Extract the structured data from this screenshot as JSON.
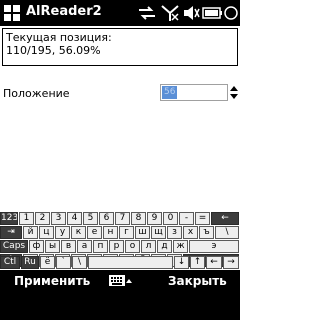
{
  "titlebar": {
    "title": "AlReader2",
    "icons": [
      "windows-start-icon",
      "sync-icon",
      "signal-off-icon",
      "volume-muted-icon",
      "battery-icon",
      "ok-icon"
    ]
  },
  "position_box": {
    "label": "Текущая позиция:",
    "value": "110/195, 56.09%"
  },
  "polozhenie": {
    "label": "Положение",
    "value": "56"
  },
  "keyboard": {
    "row0": [
      "123",
      "1",
      "2",
      "3",
      "4",
      "5",
      "6",
      "7",
      "8",
      "9",
      "0",
      "-",
      "=",
      "←"
    ],
    "row1": [
      "⇥",
      "й",
      "ц",
      "у",
      "к",
      "е",
      "н",
      "г",
      "ш",
      "щ",
      "з",
      "х",
      "ъ",
      "\\"
    ],
    "row2": [
      "Caps",
      "ф",
      "ы",
      "в",
      "а",
      "п",
      "р",
      "о",
      "л",
      "д",
      "ж",
      "э"
    ],
    "row3": [
      "⇧",
      "я",
      "ч",
      "с",
      "м",
      "и",
      "т",
      "ь",
      "б",
      "ю",
      ".",
      "↵"
    ],
    "row4": [
      "Ctl",
      "Ru",
      "ё",
      "`",
      "\\",
      "↓",
      "↑",
      "←",
      "→"
    ]
  },
  "softkeys": {
    "left": "Применить",
    "right": "Закрыть"
  },
  "colors": {
    "bar": "#000000",
    "selection": "#5b8fd6"
  }
}
